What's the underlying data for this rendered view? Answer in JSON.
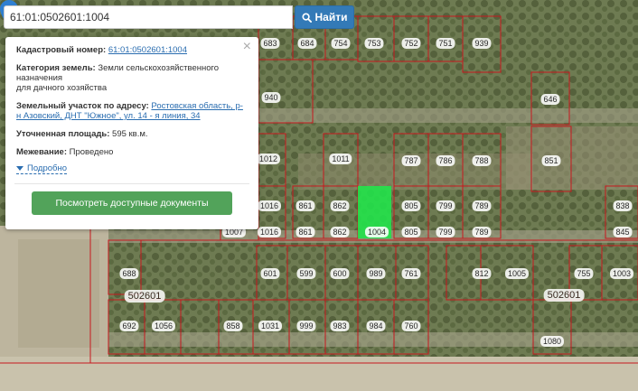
{
  "search": {
    "value": "61:01:0502601:1004",
    "button_label": "Найти"
  },
  "card": {
    "cadastral_label": "Кадастровый номер:",
    "cadastral_value": "61:01:0502601:1004",
    "category_label": "Категория земель:",
    "category_line1": "Земли сельскохозяйственного",
    "category_line2": "назначения",
    "category_line3": "для дачного хозяйства",
    "address_label": "Земельный участок по адресу:",
    "address_part1": "Ростовская область, р-",
    "address_part2": "н Азовский, ДНТ \"Южное\", ул. 14 - я линия, 34",
    "area_label": "Уточненная площадь:",
    "area_value": "595 кв.м.",
    "survey_label": "Межевание:",
    "survey_value": "Проведено",
    "more_label": "Подробно",
    "docs_button": "Посмотреть доступные документы"
  },
  "map": {
    "parcel_labels": [
      "683",
      "684",
      "754",
      "753",
      "752",
      "751",
      "939",
      "940",
      "646",
      "1012",
      "1011",
      "787",
      "786",
      "788",
      "851",
      "1016",
      "861",
      "862",
      "805",
      "799",
      "789",
      "838",
      "1007",
      "1016",
      "861",
      "862",
      "1004",
      "805",
      "799",
      "789",
      "845",
      "688",
      "601",
      "599",
      "600",
      "989",
      "761",
      "812",
      "1005",
      "755",
      "1003",
      "692",
      "1056",
      "858",
      "1031",
      "999",
      "983",
      "984",
      "760",
      "1080"
    ],
    "block_labels": [
      "502601",
      "502601"
    ],
    "colors": {
      "parcel_border": "#c8181e",
      "selected_fill": "#22e34a",
      "pin": "#2f7fd1"
    }
  }
}
